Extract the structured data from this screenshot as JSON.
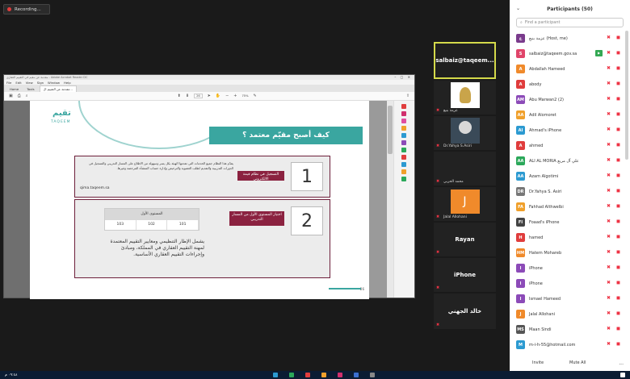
{
  "recording": {
    "label": "Recording..."
  },
  "share_window": {
    "title": "مقدمة عن مقيم في التقييم العقاري - Adobe Acrobat Reader DC",
    "window_controls": "– ▢ ✕",
    "menu": [
      "File",
      "Edit",
      "View",
      "Sign",
      "Window",
      "Help"
    ],
    "tabs": [
      "Home",
      "Tools",
      "مقدمة عن التقييم ال..."
    ],
    "zoom": "75%",
    "page": "26"
  },
  "slide": {
    "logo_ar": "تقيم",
    "logo_en": "TAQEEM",
    "title": "كيف أصبح مقيّم معتمد ؟",
    "card1": {
      "number": "1",
      "label": "التسجيل في نظام قيمة الالكتروني",
      "desc": "يقدّم هذا النظام جميع الخدمات التي تقدمها الهيئة بكل يسر وسهولة من الاطلاع على المسار التدريبي والتسجيل في الدورات التدريبية والتقديم لطلب العضوية والترخيص وإدارة حساب المنشأة المرخصة وغيرها.",
      "link": "qima.taqeem.sa"
    },
    "card2": {
      "number": "2",
      "label": "اجتياز المستوى الأول من المسار التدريبي",
      "table_header": "المستوى الأول",
      "table_cells": [
        "103",
        "102",
        "101"
      ],
      "desc": "يشمل الإطار التنظيمي ومعايير التقييم المعتمدة لمهنة التقييم العقاري في المملكة، ومبادئ وإجراءات التقييم العقاري الأساسية."
    },
    "page_number": "26"
  },
  "gallery": [
    {
      "name": "salbaiz@taqeem...",
      "caption": "",
      "active": true
    },
    {
      "name": "",
      "caption": "عزمة بنبع",
      "active": false
    },
    {
      "name": "",
      "caption": "Dr.Yahya S.Asiri",
      "active": false
    },
    {
      "name": "",
      "caption": "محمد الحربي",
      "active": false
    },
    {
      "name": "",
      "caption": "Jalal Allohani",
      "active": false,
      "initial": "J"
    },
    {
      "name": "Rayan",
      "caption": "",
      "active": false
    },
    {
      "name": "iPhone",
      "caption": "",
      "active": false
    },
    {
      "name": "خالد الجهني",
      "caption": "",
      "active": false
    }
  ],
  "participants": {
    "title": "Participants (50)",
    "search_placeholder": "Find a participant",
    "list": [
      {
        "initials": "ع",
        "color": "#7a3b8c",
        "name": "عزمة بنبع (Host, me)",
        "green": false
      },
      {
        "initials": "S",
        "color": "#e0456a",
        "name": "salbaiz@taqeem.gov.sa",
        "green": true
      },
      {
        "initials": "A",
        "color": "#f08a2b",
        "name": "Abdallah Hameed",
        "green": false
      },
      {
        "initials": "A",
        "color": "#e03d3d",
        "name": "abody",
        "green": false
      },
      {
        "initials": "AM",
        "color": "#8c4bb8",
        "name": "Abu Marwan2 (2)",
        "green": false
      },
      {
        "initials": "AA",
        "color": "#f0a02b",
        "name": "Adil Alomoret",
        "green": false
      },
      {
        "initials": "AI",
        "color": "#2c9ad1",
        "name": "Ahmad's iPhone",
        "green": false
      },
      {
        "initials": "A",
        "color": "#e03d3d",
        "name": "ahmed",
        "green": false
      },
      {
        "initials": "AA",
        "color": "#2ba85a",
        "name": "ALI AL MORIA علي آل مريع",
        "green": false
      },
      {
        "initials": "AA",
        "color": "#2c9ad1",
        "name": "Azam Algotimi",
        "green": false
      },
      {
        "initials": "DR",
        "color": "#777",
        "name": "Dr.Yahya S. Asiri",
        "green": false
      },
      {
        "initials": "FA",
        "color": "#f0a02b",
        "name": "Fahhad Althwelbi",
        "green": false
      },
      {
        "initials": "FI",
        "color": "#444",
        "name": "Foaad's iPhone",
        "green": false
      },
      {
        "initials": "H",
        "color": "#e03d3d",
        "name": "hamed",
        "green": false
      },
      {
        "initials": "HM",
        "color": "#f08a2b",
        "name": "Hatem Mohareb",
        "green": false
      },
      {
        "initials": "I",
        "color": "#8c4bb8",
        "name": "iPhone",
        "green": false
      },
      {
        "initials": "I",
        "color": "#8c4bb8",
        "name": "iPhone",
        "green": false
      },
      {
        "initials": "I",
        "color": "#8c4bb8",
        "name": "Ismael Hameed",
        "green": false
      },
      {
        "initials": "J",
        "color": "#f08a2b",
        "name": "Jalal Allohani",
        "green": false
      },
      {
        "initials": "MS",
        "color": "#555",
        "name": "Maan Sindi",
        "green": false
      },
      {
        "initials": "M",
        "color": "#2c9ad1",
        "name": "m-i-h-55@hotmail.com",
        "green": false
      }
    ],
    "invite": "Invite",
    "mute_all": "Mute All",
    "more": "..."
  },
  "taskbar": {
    "clock": "٠٩:٤٨ م"
  }
}
